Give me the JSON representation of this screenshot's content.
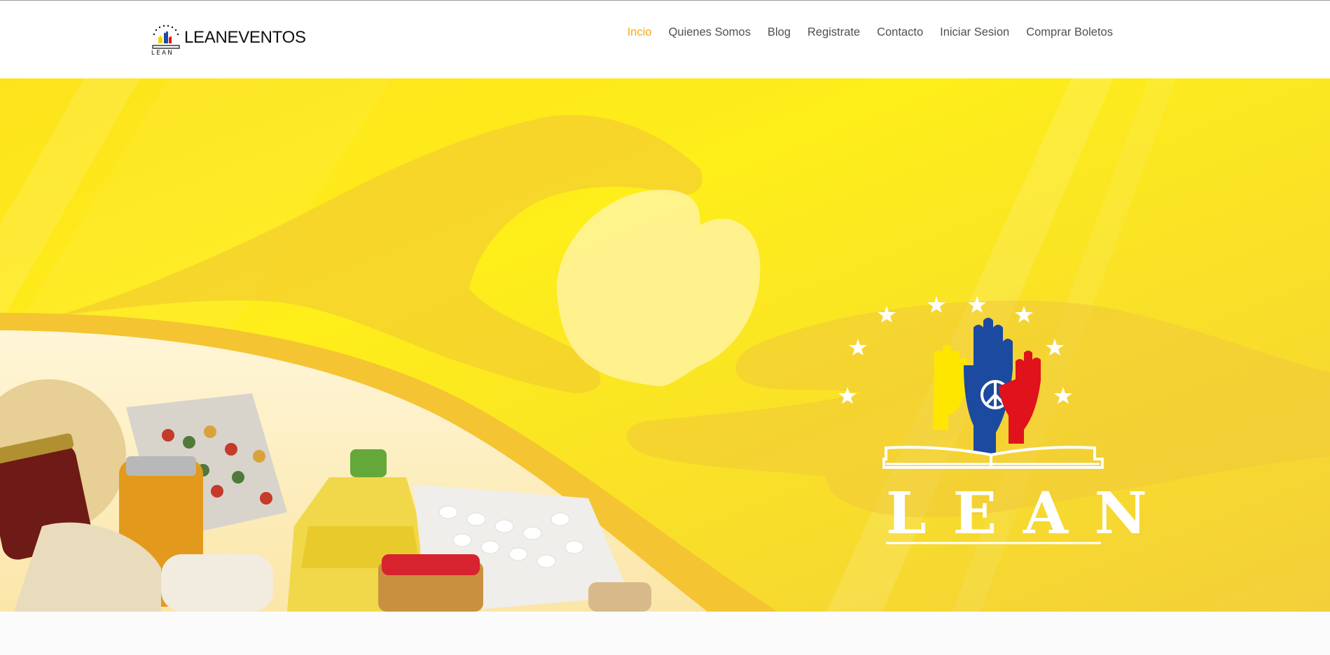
{
  "header": {
    "brand_name": "LEANEVENTOS",
    "logo_icon": "lean-hands-logo-icon"
  },
  "nav": {
    "items": [
      {
        "label": "Incio",
        "active": true
      },
      {
        "label": "Quienes Somos",
        "active": false
      },
      {
        "label": "Blog",
        "active": false
      },
      {
        "label": "Registrate",
        "active": false
      },
      {
        "label": "Contacto",
        "active": false
      },
      {
        "label": "Iniciar Sesion",
        "active": false
      },
      {
        "label": "Comprar Boletos",
        "active": false
      }
    ],
    "active_color": "#f5ab0f",
    "text_color": "#505050"
  },
  "hero": {
    "logo_text": "LEAN",
    "background_color": "#fbe51d",
    "accent_colors": {
      "yellow": "#ffe600",
      "blue": "#1b4aa0",
      "red": "#e0121b"
    },
    "slider": {
      "slide_count": 3,
      "active_slide": 1
    }
  }
}
